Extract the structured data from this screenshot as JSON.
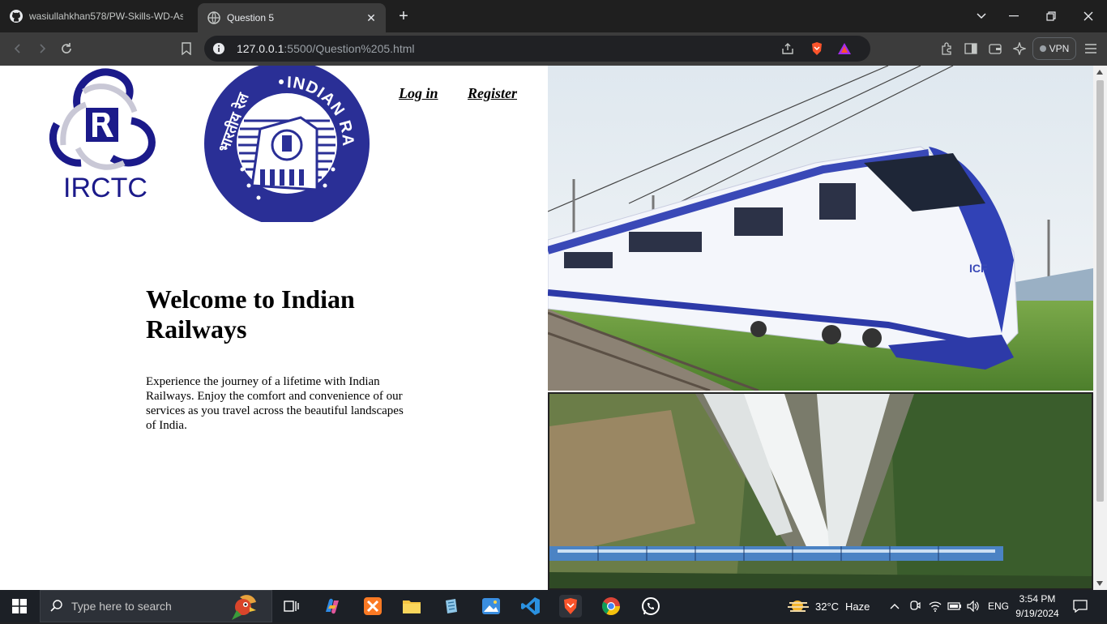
{
  "browser": {
    "tabs": [
      {
        "title": "wasiullahkhan578/PW-Skills-WD-As",
        "icon": "github-icon"
      },
      {
        "title": "Question 5",
        "icon": "globe-icon",
        "active": true
      }
    ],
    "url_host": "127.0.0.1",
    "url_path": ":5500/Question%205.html",
    "vpn_label": "VPN"
  },
  "page": {
    "logos": {
      "irctc_text": "IRCTC",
      "ir_text": "INDIAN RAILWAYS",
      "ir_hindi": "भारतीय रेल"
    },
    "nav": {
      "login": "Log in",
      "register": "Register"
    },
    "heading": "Welcome to Indian Railways",
    "description": "Experience the journey of a lifetime with Indian Railways. Enjoy the comfort and convenience of our services as you travel across the beautiful landscapes of India.",
    "train_label": "ICF"
  },
  "taskbar": {
    "search_placeholder": "Type here to search",
    "weather_temp": "32°C",
    "weather_desc": "Haze",
    "language": "ENG",
    "time": "3:54 PM",
    "date": "9/19/2024"
  },
  "colors": {
    "irctc_blue": "#1b1a8a",
    "ir_blue": "#2a2f96",
    "brave_orange": "#fb542b"
  }
}
